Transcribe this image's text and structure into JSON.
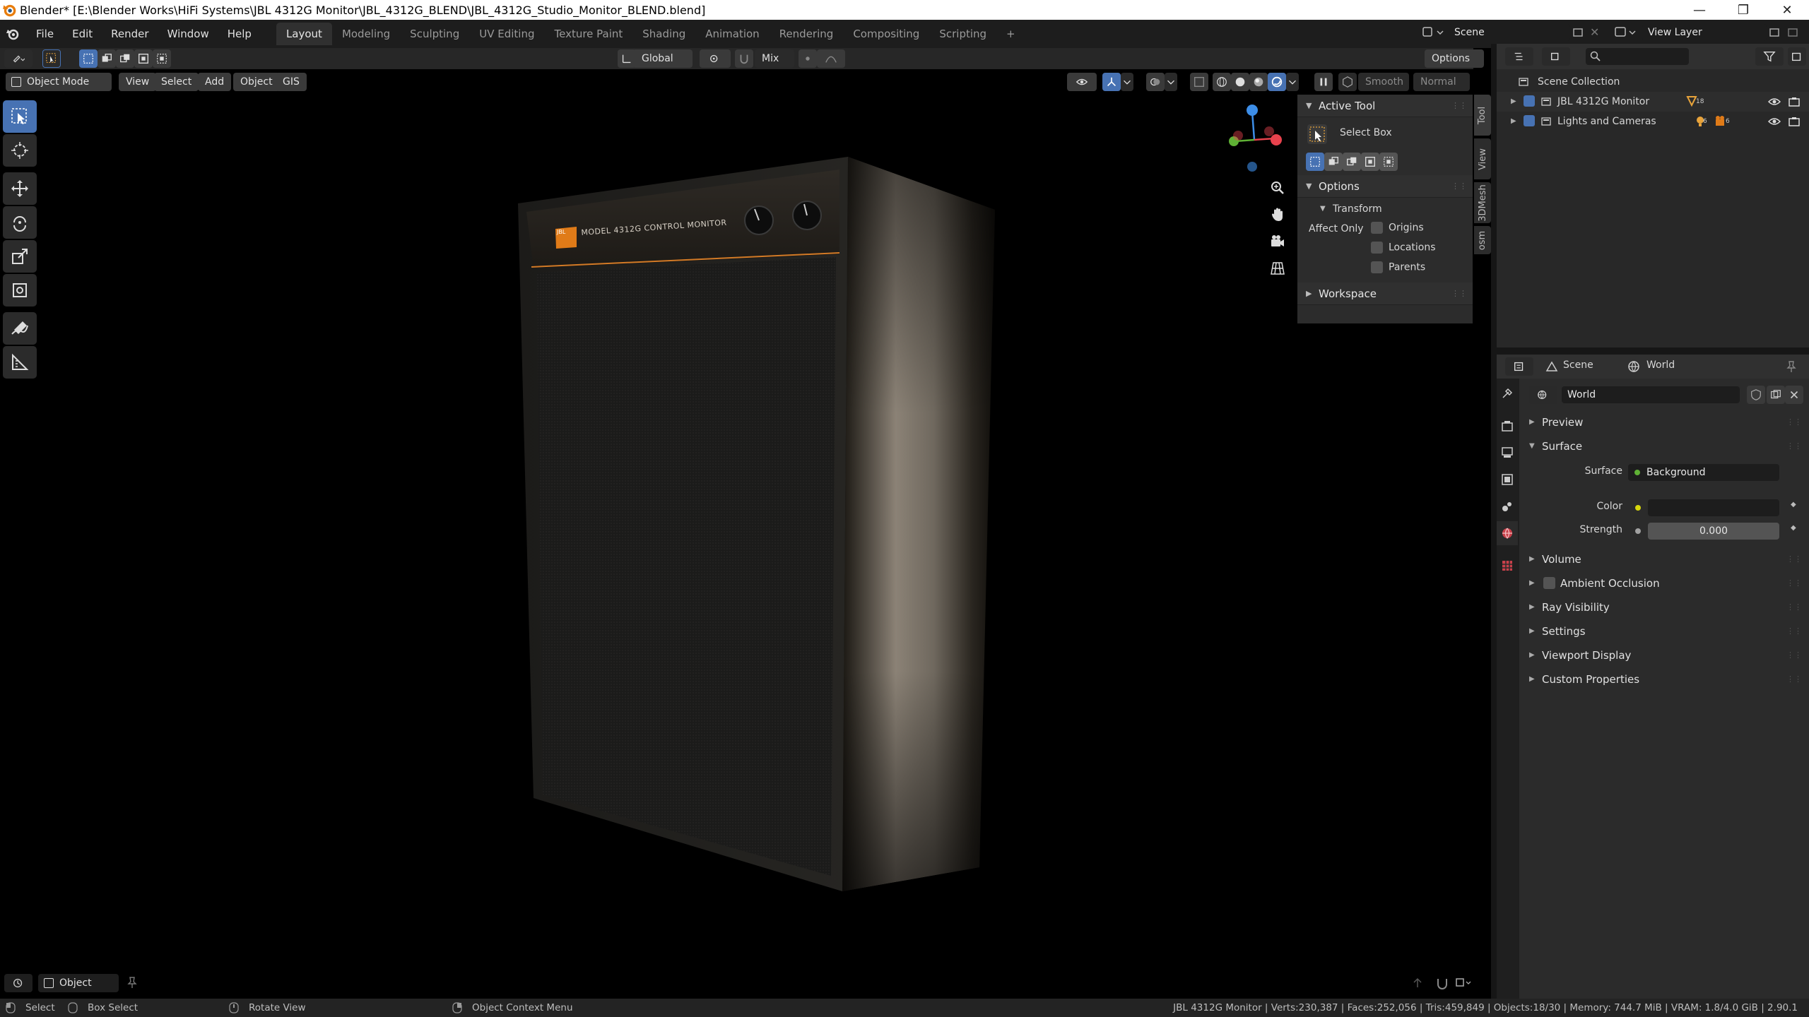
{
  "window": {
    "title": "Blender* [E:\\Blender Works\\HiFi Systems\\JBL 4312G Monitor\\JBL_4312G_BLEND\\JBL_4312G_Studio_Monitor_BLEND.blend]",
    "minimize": "—",
    "maximize": "❐",
    "close": "✕"
  },
  "menu": [
    "File",
    "Edit",
    "Render",
    "Window",
    "Help"
  ],
  "workspaces": [
    "Layout",
    "Modeling",
    "Sculpting",
    "UV Editing",
    "Texture Paint",
    "Shading",
    "Animation",
    "Rendering",
    "Compositing",
    "Scripting",
    "+"
  ],
  "scene_selector": {
    "scene": "Scene",
    "view_layer": "View Layer"
  },
  "viewport_header": {
    "transform_orientation": "Global",
    "pivot_mix": "Mix",
    "options": "Options",
    "mode": "Object Mode",
    "menus": [
      "View",
      "Select",
      "Add",
      "Object",
      "GIS"
    ],
    "shading_smooth": "Smooth",
    "shading_normal": "Normal"
  },
  "npanel": {
    "active_tool_header": "Active Tool",
    "tool_name": "Select Box",
    "options_header": "Options",
    "transform_header": "Transform",
    "affect_only": "Affect Only",
    "origins": "Origins",
    "locations": "Locations",
    "parents": "Parents",
    "workspace_header": "Workspace",
    "tabs": [
      "Tool",
      "View",
      "3DMesh",
      "osm"
    ]
  },
  "outliner": {
    "root": "Scene Collection",
    "items": [
      {
        "name": "JBL 4312G Monitor",
        "badge": "18"
      },
      {
        "name": "Lights and Cameras",
        "badge1": "6",
        "badge2": "6"
      }
    ]
  },
  "properties": {
    "context_scene": "Scene",
    "context_world": "World",
    "world_name": "World",
    "panels": {
      "preview": "Preview",
      "surface": "Surface",
      "volume": "Volume",
      "ambient_occlusion": "Ambient Occlusion",
      "ray_visibility": "Ray Visibility",
      "settings": "Settings",
      "viewport_display": "Viewport Display",
      "custom_properties": "Custom Properties"
    },
    "surface_label": "Surface",
    "surface_value": "Background",
    "color_label": "Color",
    "strength_label": "Strength",
    "strength_value": "0.000"
  },
  "speaker": {
    "badge": "JBL",
    "label": "MODEL 4312G CONTROL MONITOR"
  },
  "footer": {
    "mode": "Object"
  },
  "statusbar": {
    "select": "Select",
    "box_select": "Box Select",
    "rotate_view": "Rotate View",
    "context_menu": "Object Context Menu",
    "stats": "JBL 4312G Monitor | Verts:230,387 | Faces:252,056 | Tris:459,849 | Objects:18/30 | Memory: 744.7 MiB | VRAM: 1.8/4.0 GiB | 2.90.1"
  },
  "colors": {
    "accent": "#4772b3",
    "axis_x": "#e8424d",
    "axis_y": "#5fb135",
    "axis_z": "#3d8ee8",
    "orange": "#e07b18"
  }
}
